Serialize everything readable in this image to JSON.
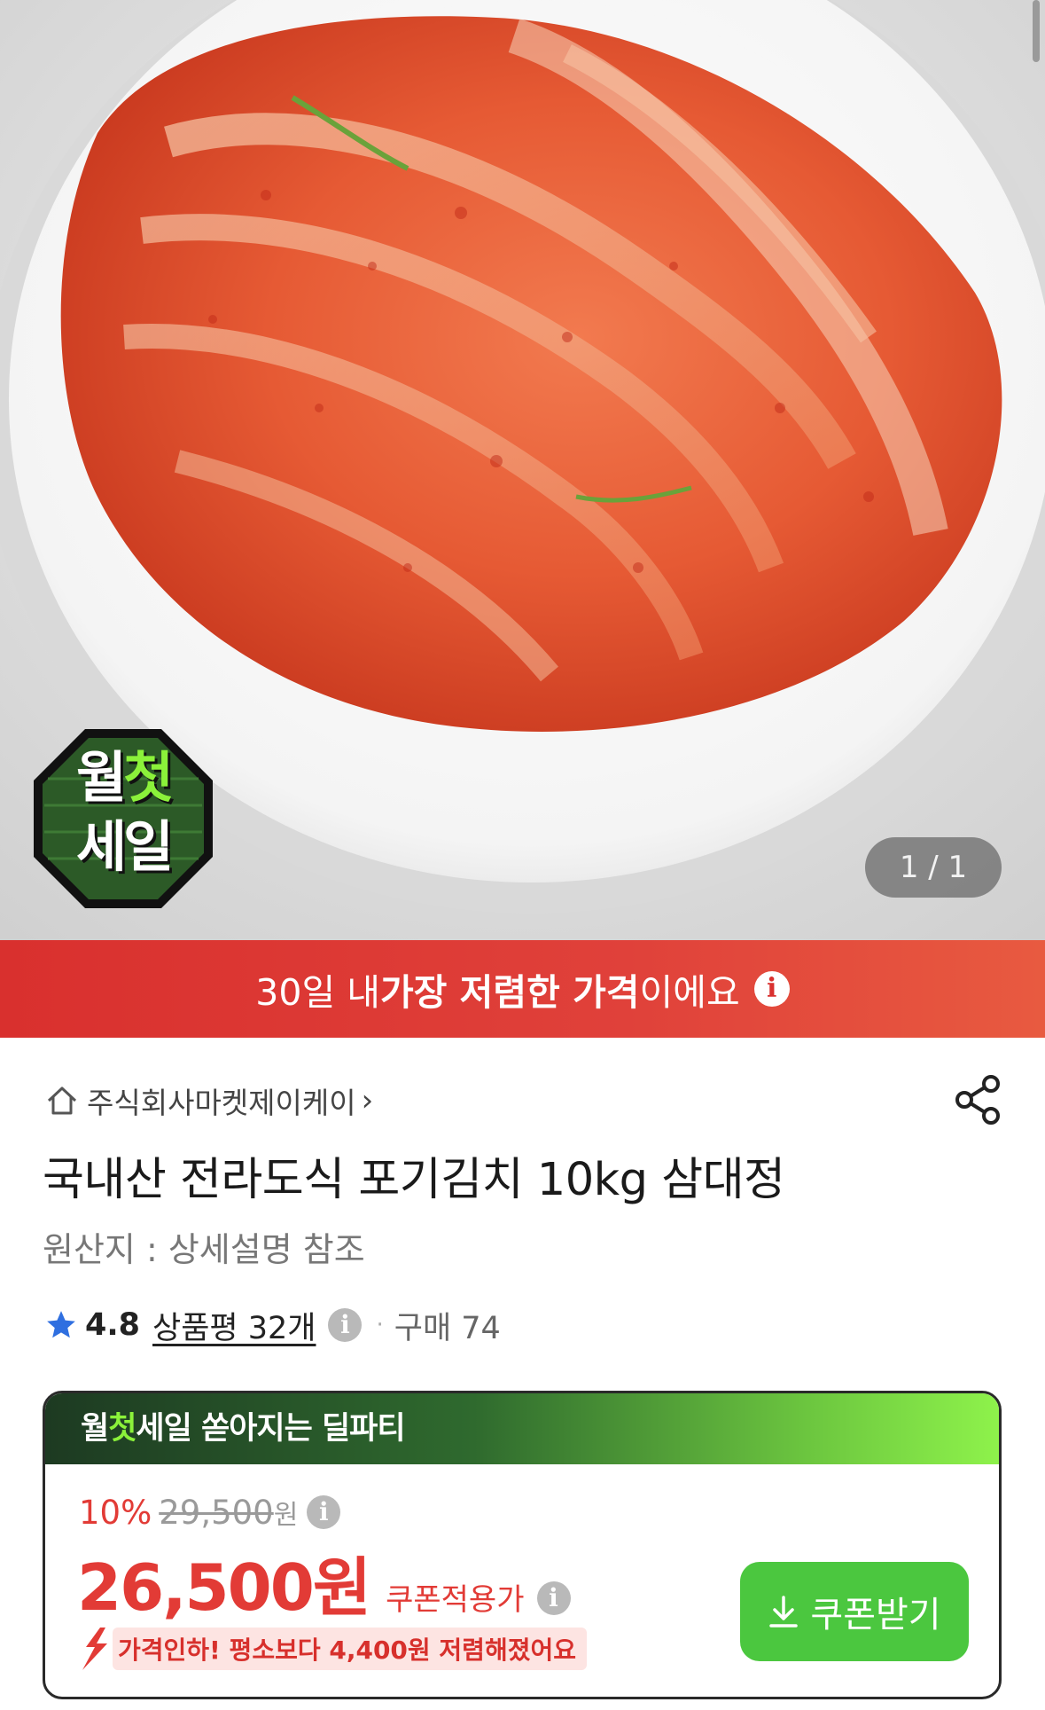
{
  "hero": {
    "badge_line1_a": "월",
    "badge_line1_b": "첫",
    "badge_line2": "세일",
    "pager": "1 / 1",
    "icon": "kimchi-product-photo"
  },
  "price_banner": {
    "prefix": "30일 내 ",
    "highlight": "가장 저렴한 가격",
    "suffix": "이에요",
    "info_icon": "info-icon"
  },
  "product": {
    "seller_name": "주식회사마켓제이케이",
    "seller_chevron": "›",
    "title": "국내산 전라도식 포기김치 10kg 삼대정",
    "origin": "원산지 : 상세설명 참조",
    "rating": "4.8",
    "review_label": "상품평 32개",
    "dot": "·",
    "purchase": "구매 74"
  },
  "deal": {
    "head_a": "월",
    "head_b": "첫",
    "head_c": "세일",
    "head_d": " 쏟아지는 딜파티",
    "discount_pct": "10%",
    "original_price": "29,500",
    "original_won": "원",
    "final_price": "26,500원",
    "final_label": "쿠폰적용가",
    "drop_text": "가격인하! 평소보다 4,400원 저렴해졌어요",
    "coupon_button": "쿠폰받기"
  },
  "colors": {
    "accent_red": "#e23b36",
    "banner_red": "#d9302e",
    "coupon_green": "#4bc73f",
    "deal_green": "#8ef24b"
  }
}
